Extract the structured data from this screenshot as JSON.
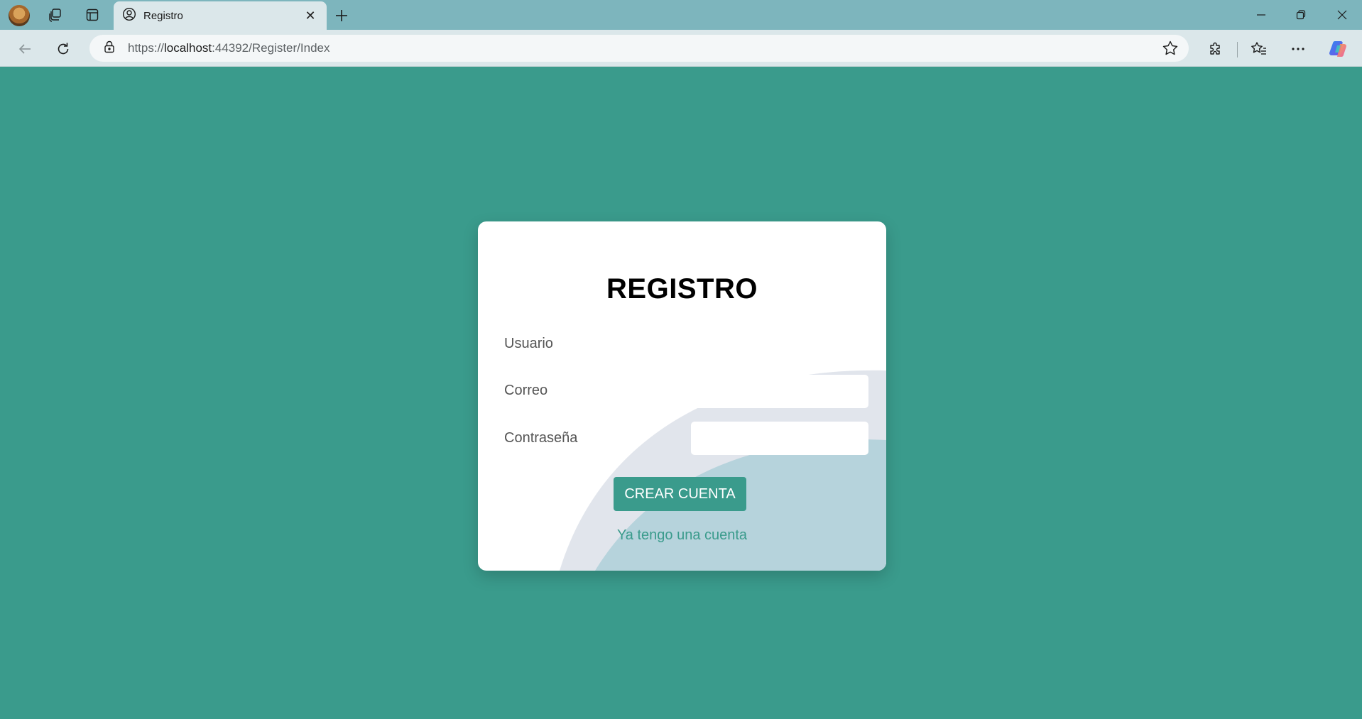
{
  "browser": {
    "tab_title": "Registro",
    "url_scheme": "https://",
    "url_host": "localhost",
    "url_rest": ":44392/Register/Index"
  },
  "form": {
    "title": "REGISTRO",
    "fields": [
      {
        "label": "Usuario",
        "value": "",
        "placeholder": ""
      },
      {
        "label": "Correo",
        "value": "",
        "placeholder": ""
      },
      {
        "label": "Contraseña",
        "value": "",
        "placeholder": ""
      }
    ],
    "submit_label": "CREAR CUENTA",
    "login_link": "Ya tengo una cuenta"
  },
  "colors": {
    "page_background": "#3a9b8c",
    "card_background": "#ffffff",
    "primary_button": "#3a9b8c",
    "link": "#3a9b8c",
    "wave_light": "#e1e5ec",
    "wave_dark": "#b6d3dc",
    "titlebar": "#7db5bd",
    "toolbar": "#dbe7ea"
  },
  "icons": {
    "profile": "profile-avatar-icon",
    "workspaces": "workspaces-icon",
    "tab_actions": "tab-actions-icon",
    "tab_favicon": "user-circle-icon",
    "close_tab": "close-icon",
    "new_tab": "plus-icon",
    "back": "back-arrow-icon",
    "refresh": "refresh-icon",
    "lock": "lock-icon",
    "favorite": "star-icon",
    "extensions": "puzzle-icon",
    "favorites": "favorites-icon",
    "menu": "ellipsis-icon",
    "copilot": "copilot-icon"
  }
}
